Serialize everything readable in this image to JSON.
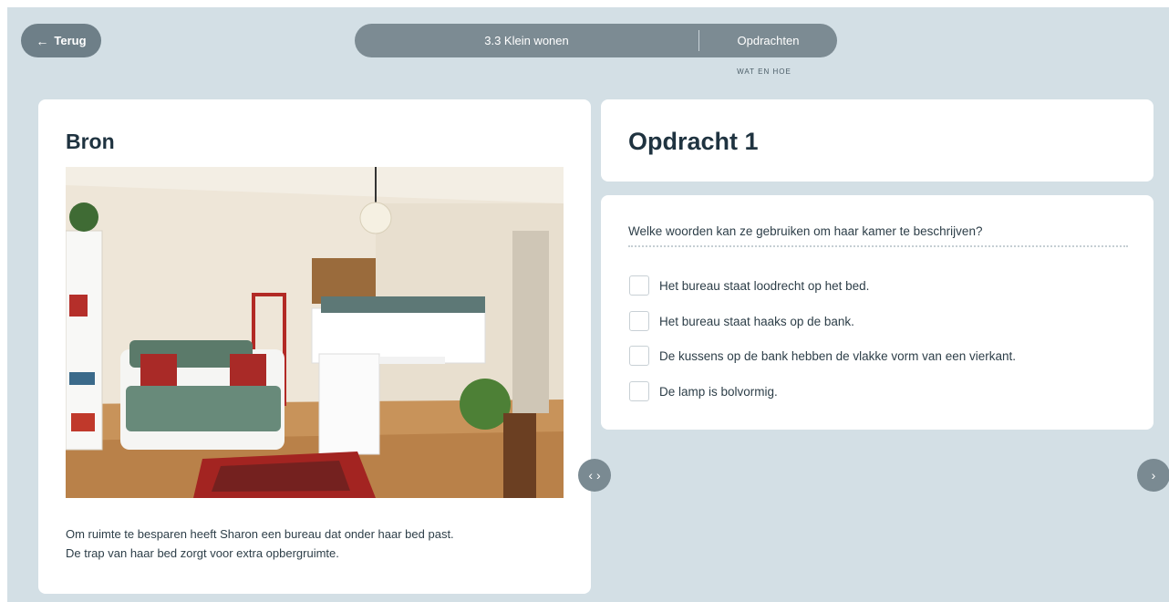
{
  "header": {
    "back_label": "Terug",
    "lesson_title": "3.3 Klein wonen",
    "section_label": "Opdrachten",
    "section_sublabel": "WAT EN HOE"
  },
  "source": {
    "heading": "Bron",
    "caption_line1": "Om ruimte te besparen heeft Sharon een bureau dat onder haar bed past.",
    "caption_line2": "De trap van haar bed zorgt voor extra opbergruimte."
  },
  "assignment": {
    "title": "Opdracht 1",
    "question": "Welke woorden kan ze gebruiken om haar kamer te beschrijven?",
    "options": [
      {
        "label": "Het bureau staat loodrecht op het bed.",
        "checked": false
      },
      {
        "label": "Het bureau staat haaks op de bank.",
        "checked": false
      },
      {
        "label": "De kussens op de bank hebben de vlakke vorm van een vierkant.",
        "checked": false
      },
      {
        "label": "De lamp is bolvormig.",
        "checked": false
      }
    ]
  },
  "icons": {
    "back": "arrow-left-icon",
    "nav_mid": "chevron-left-right-icon",
    "nav_next": "chevron-right-icon"
  },
  "colors": {
    "background": "#d3dfe5",
    "pill": "#7c8b93",
    "heading": "#1f3340"
  }
}
